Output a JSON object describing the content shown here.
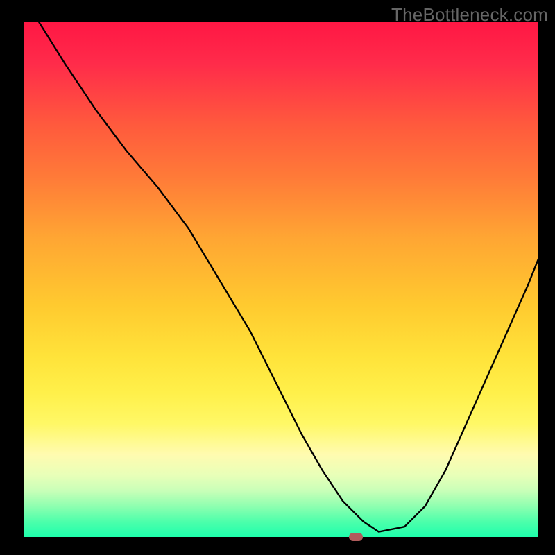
{
  "watermark": "TheBottleneck.com",
  "chart_data": {
    "type": "line",
    "title": "",
    "xlabel": "",
    "ylabel": "",
    "xlim": [
      0,
      100
    ],
    "ylim": [
      0,
      100
    ],
    "x": [
      3,
      8,
      14,
      20,
      26,
      32,
      38,
      44,
      50,
      54,
      58,
      62,
      66,
      69,
      74,
      78,
      82,
      86,
      90,
      94,
      98,
      100
    ],
    "values": [
      100,
      92,
      83,
      75,
      68,
      60,
      50,
      40,
      28,
      20,
      13,
      7,
      3,
      1,
      2,
      6,
      13,
      22,
      31,
      40,
      49,
      54
    ],
    "marker": {
      "x": 64.5,
      "y": 0
    },
    "colors": {
      "gradient_top": "#ff1744",
      "gradient_bottom": "#1effac",
      "line": "#000000",
      "marker": "#b05c5c"
    }
  }
}
